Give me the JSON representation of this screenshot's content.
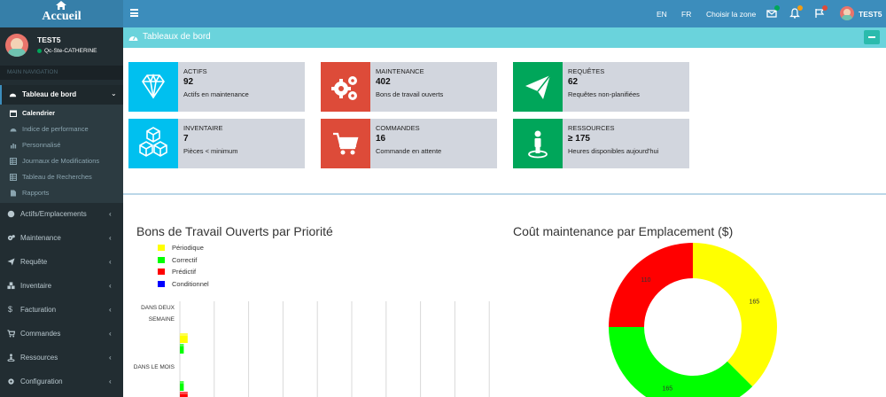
{
  "app": {
    "logo_text": "Accueil"
  },
  "topbar": {
    "lang_en": "EN",
    "lang_fr": "FR",
    "zone": "Choisir la zone",
    "user": "TEST5",
    "icons": [
      "envelope-icon",
      "bell-icon",
      "flag-icon"
    ],
    "badges": {
      "envelope": "",
      "bell": "",
      "flag": ""
    }
  },
  "sidebar": {
    "user_name": "TEST5",
    "user_location": "Qc-Ste-CATHERINE",
    "nav_header": "MAIN NAVIGATION",
    "dashboard": {
      "label": "Tableau de bord"
    },
    "submenu": [
      {
        "label": "Calendrier"
      },
      {
        "label": "Indice de performance"
      },
      {
        "label": "Personnalisé"
      },
      {
        "label": "Journaux de Modifications"
      },
      {
        "label": "Tableau de Recherches"
      },
      {
        "label": "Rapports"
      }
    ],
    "items": [
      {
        "label": "Actifs/Emplacements"
      },
      {
        "label": "Maintenance"
      },
      {
        "label": "Requête"
      },
      {
        "label": "Inventaire"
      },
      {
        "label": "Facturation"
      },
      {
        "label": "Commandes"
      },
      {
        "label": "Ressources"
      },
      {
        "label": "Configuration"
      }
    ]
  },
  "content": {
    "title": "Tableaux de bord",
    "boxes": [
      {
        "text": "ACTIFS",
        "number": "92",
        "desc": "Actifs en maintenance",
        "color": "#00c0ef",
        "icon": "diamond-icon"
      },
      {
        "text": "MAINTENANCE",
        "number": "402",
        "desc": "Bons de travail ouverts",
        "color": "#dd4b39",
        "icon": "gears-icon"
      },
      {
        "text": "REQUÊTES",
        "number": "62",
        "desc": "Requêtes non-planifiées",
        "color": "#00a65a",
        "icon": "paper-plane-icon"
      },
      {
        "text": "INVENTAIRE",
        "number": "7",
        "desc": "Pièces < minimum",
        "color": "#00c0ef",
        "icon": "cubes-icon"
      },
      {
        "text": "COMMANDES",
        "number": "16",
        "desc": "Commande en attente",
        "color": "#dd4b39",
        "icon": "cart-icon"
      },
      {
        "text": "RESSOURCES",
        "number": "≥ 175",
        "desc": "Heures disponibles aujourd'hui",
        "color": "#00a65a",
        "icon": "person-pin-icon"
      }
    ]
  },
  "chart_data": [
    {
      "type": "bar",
      "title": "Bons de Travail Ouverts par Priorité",
      "orientation": "horizontal",
      "legend": [
        "Périodique",
        "Correctif",
        "Prédictif",
        "Conditionnel"
      ],
      "colors": [
        "#ffff00",
        "#00ff00",
        "#ff0000",
        "#0000ff"
      ],
      "categories": [
        "DANS DEUX SEMAINE",
        "DANS LE MOIS"
      ],
      "series": [
        {
          "name": "Périodique",
          "values": [
            4,
            null
          ]
        },
        {
          "name": "Correctif",
          "values": [
            2,
            2
          ]
        },
        {
          "name": "Prédictif",
          "values": [
            null,
            4
          ]
        },
        {
          "name": "Conditionnel",
          "values": [
            null,
            null
          ]
        }
      ],
      "grid": true
    },
    {
      "type": "pie",
      "title": "Coût maintenance par Emplacement ($)",
      "donut": true,
      "values": [
        165,
        165,
        110
      ],
      "labels": [
        "165",
        "165",
        "110"
      ],
      "colors": [
        "#ffff00",
        "#00ff00",
        "#ff0000"
      ]
    }
  ]
}
